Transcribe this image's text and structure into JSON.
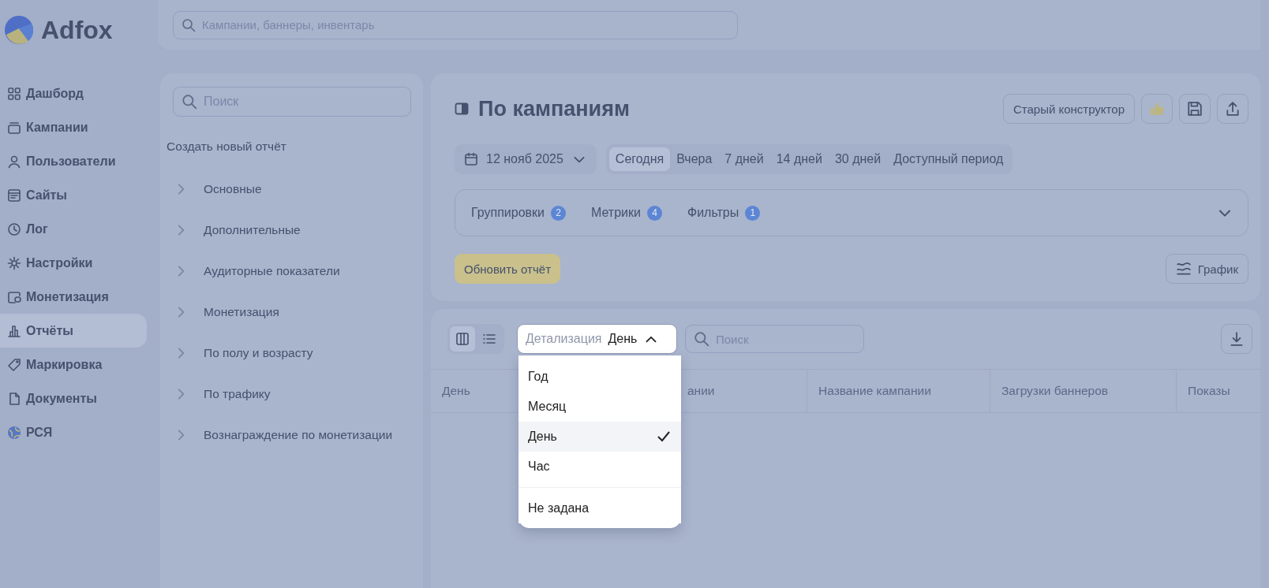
{
  "logo": {
    "text": "Adfox"
  },
  "top_search": {
    "placeholder": "Кампании, баннеры, инвентарь"
  },
  "sidebar": {
    "items": [
      {
        "label": "Дашборд",
        "selected": false
      },
      {
        "label": "Кампании",
        "selected": false
      },
      {
        "label": "Пользователи",
        "selected": false
      },
      {
        "label": "Сайты",
        "selected": false
      },
      {
        "label": "Лог",
        "selected": false
      },
      {
        "label": "Настройки",
        "selected": false
      },
      {
        "label": "Монетизация",
        "selected": false
      },
      {
        "label": "Отчёты",
        "selected": true
      },
      {
        "label": "Маркировка",
        "selected": false
      },
      {
        "label": "Документы",
        "selected": false
      },
      {
        "label": "РСЯ",
        "selected": false
      }
    ]
  },
  "reports_panel": {
    "search": {
      "placeholder": "Поиск"
    },
    "create_label": "Создать новый отчёт",
    "groups": [
      {
        "label": "Основные",
        "expanded": false
      },
      {
        "label": "Дополнительные",
        "expanded": false
      },
      {
        "label": "Аудиторные показатели",
        "expanded": false
      },
      {
        "label": "Монетизация",
        "expanded": false
      },
      {
        "label": "По полу и возрасту",
        "expanded": false
      },
      {
        "label": "По трафику",
        "expanded": false
      },
      {
        "label": "Вознаграждение по монетизации",
        "expanded": false
      }
    ]
  },
  "report": {
    "title": "По кампаниям",
    "old_builder_button": "Старый конструктор",
    "date": "12 нояб 2025",
    "periods": [
      {
        "label": "Сегодня",
        "selected": true
      },
      {
        "label": "Вчера",
        "selected": false
      },
      {
        "label": "7 дней",
        "selected": false
      },
      {
        "label": "14 дней",
        "selected": false
      },
      {
        "label": "30 дней",
        "selected": false
      },
      {
        "label": "Доступный период",
        "selected": false
      }
    ],
    "sections": [
      {
        "label": "Группировки",
        "count": "2"
      },
      {
        "label": "Метрики",
        "count": "4"
      },
      {
        "label": "Фильтры",
        "count": "1"
      }
    ],
    "update_button": "Обновить отчёт",
    "chart_button": "График"
  },
  "table_toolbar": {
    "views": [
      {
        "selected": true
      },
      {
        "selected": false
      }
    ],
    "detail": {
      "label": "Детализация",
      "value": "День",
      "expanded": true
    },
    "search": {
      "placeholder": "Поиск"
    }
  },
  "table": {
    "columns": [
      "День",
      "ании",
      "Название кампании",
      "Загрузки баннеров",
      "Показы"
    ]
  },
  "detail_menu": {
    "options": [
      {
        "label": "Год",
        "kind": "option",
        "selected": false
      },
      {
        "label": "Месяц",
        "kind": "option",
        "selected": false
      },
      {
        "label": "День",
        "kind": "option",
        "selected": true
      },
      {
        "label": "Час",
        "kind": "option",
        "selected": false
      },
      {
        "label": "Не задана",
        "kind": "reset",
        "selected": false
      }
    ]
  }
}
